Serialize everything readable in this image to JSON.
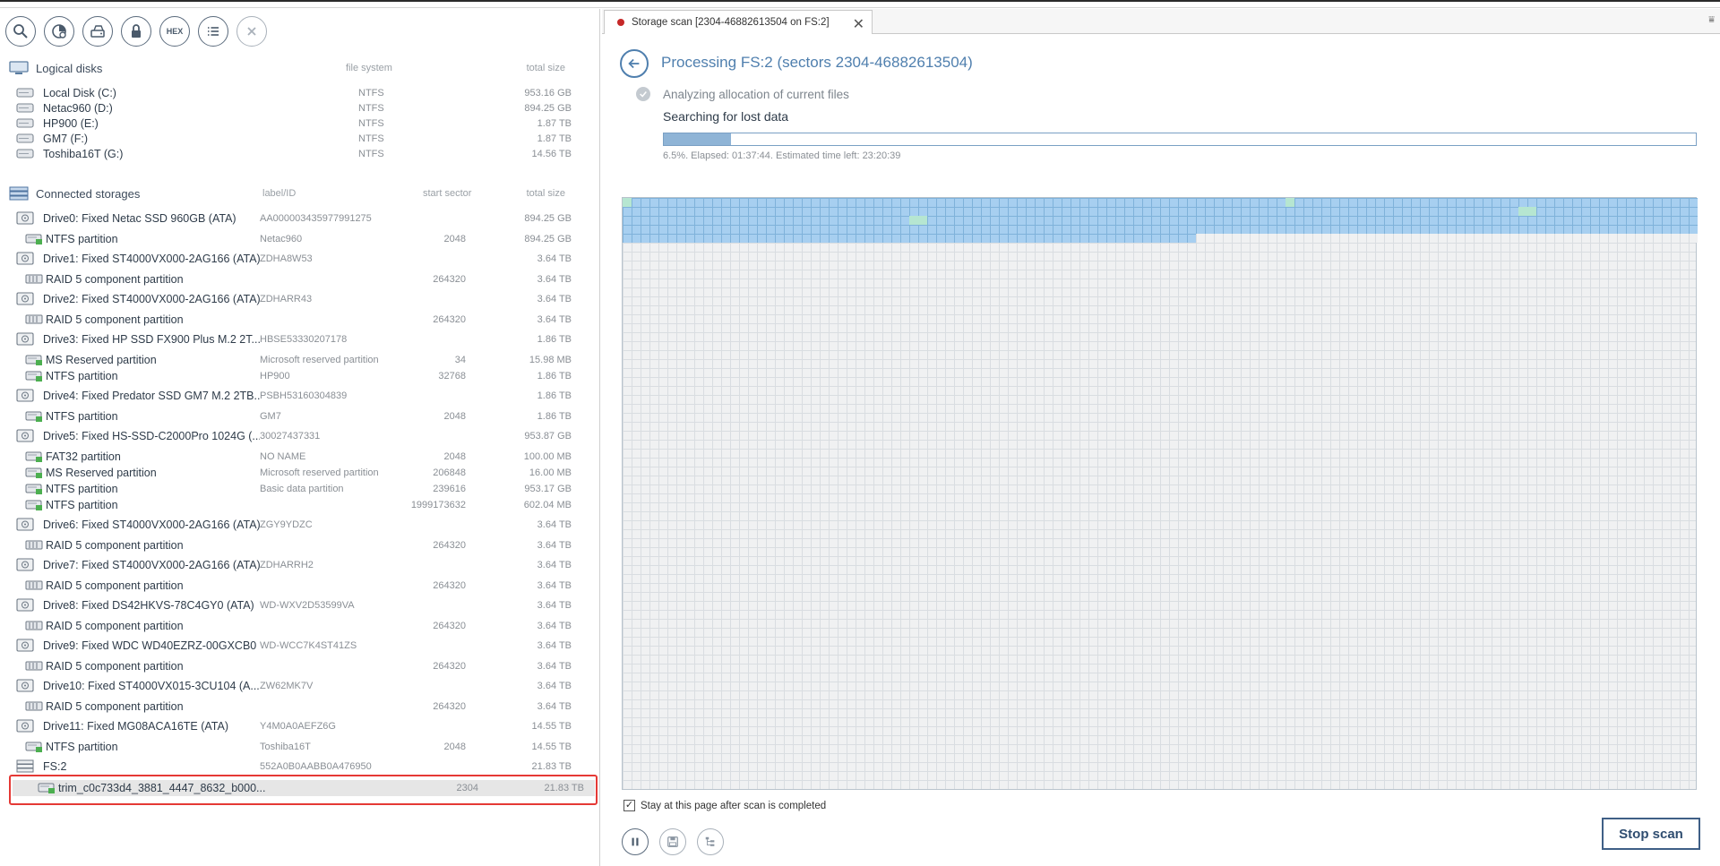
{
  "toolbar": {
    "buttons": [
      "search-icon",
      "scan-icon",
      "disk-image-icon",
      "lock-icon",
      "hex-icon",
      "list-icon",
      "close-icon"
    ],
    "hex_label": "HEX"
  },
  "logical": {
    "title": "Logical disks",
    "col_fs": "file system",
    "col_size": "total size",
    "items": [
      {
        "name": "Local Disk (C:)",
        "fs": "NTFS",
        "size": "953.16 GB"
      },
      {
        "name": "Netac960 (D:)",
        "fs": "NTFS",
        "size": "894.25 GB"
      },
      {
        "name": "HP900 (E:)",
        "fs": "NTFS",
        "size": "1.87 TB"
      },
      {
        "name": "GM7 (F:)",
        "fs": "NTFS",
        "size": "1.87 TB"
      },
      {
        "name": "Toshiba16T (G:)",
        "fs": "NTFS",
        "size": "14.56 TB"
      }
    ]
  },
  "storages": {
    "title": "Connected storages",
    "col_label": "label/ID",
    "col_start": "start sector",
    "col_size": "total size",
    "items": [
      {
        "kind": "drive",
        "name": "Drive0: Fixed Netac SSD 960GB (ATA)",
        "label": "AA000003435977991275",
        "start": "",
        "size": "894.25 GB"
      },
      {
        "kind": "part",
        "name": "NTFS partition",
        "label": "Netac960",
        "start": "2048",
        "size": "894.25 GB"
      },
      {
        "kind": "drive",
        "name": "Drive1: Fixed ST4000VX000-2AG166 (ATA)",
        "label": "ZDHA8W53",
        "start": "",
        "size": "3.64 TB"
      },
      {
        "kind": "raid",
        "name": "RAID 5 component partition",
        "label": "",
        "start": "264320",
        "size": "3.64 TB"
      },
      {
        "kind": "drive",
        "name": "Drive2: Fixed ST4000VX000-2AG166 (ATA)",
        "label": "ZDHARR43",
        "start": "",
        "size": "3.64 TB"
      },
      {
        "kind": "raid",
        "name": "RAID 5 component partition",
        "label": "",
        "start": "264320",
        "size": "3.64 TB"
      },
      {
        "kind": "drive",
        "name": "Drive3: Fixed HP SSD FX900 Plus M.2 2T...",
        "label": "HBSE53330207178",
        "start": "",
        "size": "1.86 TB"
      },
      {
        "kind": "part",
        "name": "MS Reserved partition",
        "label": "Microsoft reserved partition",
        "start": "34",
        "size": "15.98 MB"
      },
      {
        "kind": "part",
        "name": "NTFS partition",
        "label": "HP900",
        "start": "32768",
        "size": "1.86 TB"
      },
      {
        "kind": "drive",
        "name": "Drive4: Fixed Predator SSD GM7 M.2 2TB...",
        "label": "PSBH53160304839",
        "start": "",
        "size": "1.86 TB"
      },
      {
        "kind": "part",
        "name": "NTFS partition",
        "label": "GM7",
        "start": "2048",
        "size": "1.86 TB"
      },
      {
        "kind": "drive",
        "name": "Drive5: Fixed HS-SSD-C2000Pro 1024G (...",
        "label": "30027437331",
        "start": "",
        "size": "953.87 GB"
      },
      {
        "kind": "part",
        "name": "FAT32 partition",
        "label": "NO NAME",
        "start": "2048",
        "size": "100.00 MB"
      },
      {
        "kind": "part",
        "name": "MS Reserved partition",
        "label": "Microsoft reserved partition",
        "start": "206848",
        "size": "16.00 MB"
      },
      {
        "kind": "part",
        "name": "NTFS partition",
        "label": "Basic data partition",
        "start": "239616",
        "size": "953.17 GB"
      },
      {
        "kind": "part",
        "name": "NTFS partition",
        "label": "",
        "start": "1999173632",
        "size": "602.04 MB"
      },
      {
        "kind": "drive",
        "name": "Drive6: Fixed ST4000VX000-2AG166 (ATA)",
        "label": "ZGY9YDZC",
        "start": "",
        "size": "3.64 TB"
      },
      {
        "kind": "raid",
        "name": "RAID 5 component partition",
        "label": "",
        "start": "264320",
        "size": "3.64 TB"
      },
      {
        "kind": "drive",
        "name": "Drive7: Fixed ST4000VX000-2AG166 (ATA)",
        "label": "ZDHARRH2",
        "start": "",
        "size": "3.64 TB"
      },
      {
        "kind": "raid",
        "name": "RAID 5 component partition",
        "label": "",
        "start": "264320",
        "size": "3.64 TB"
      },
      {
        "kind": "drive",
        "name": "Drive8: Fixed DS42HKVS-78C4GY0 (ATA)",
        "label": "WD-WXV2D53599VA",
        "start": "",
        "size": "3.64 TB"
      },
      {
        "kind": "raid",
        "name": "RAID 5 component partition",
        "label": "",
        "start": "264320",
        "size": "3.64 TB"
      },
      {
        "kind": "drive",
        "name": "Drive9: Fixed WDC WD40EZRZ-00GXCB0 ...",
        "label": "WD-WCC7K4ST41ZS",
        "start": "",
        "size": "3.64 TB"
      },
      {
        "kind": "raid",
        "name": "RAID 5 component partition",
        "label": "",
        "start": "264320",
        "size": "3.64 TB"
      },
      {
        "kind": "drive",
        "name": "Drive10: Fixed ST4000VX015-3CU104 (A...",
        "label": "ZW62MK7V",
        "start": "",
        "size": "3.64 TB"
      },
      {
        "kind": "raid",
        "name": "RAID 5 component partition",
        "label": "",
        "start": "264320",
        "size": "3.64 TB"
      },
      {
        "kind": "drive",
        "name": "Drive11: Fixed MG08ACA16TE (ATA)",
        "label": "Y4M0A0AEFZ6G",
        "start": "",
        "size": "14.55 TB"
      },
      {
        "kind": "part",
        "name": "NTFS partition",
        "label": "Toshiba16T",
        "start": "2048",
        "size": "14.55 TB"
      },
      {
        "kind": "fs",
        "name": "FS:2",
        "label": "552A0B0AABB0A476950",
        "start": "",
        "size": "21.83 TB"
      },
      {
        "kind": "part",
        "name": "trim_c0c733d4_3881_4447_8632_b000...",
        "label": "",
        "start": "2304",
        "size": "21.83 TB",
        "selected": true
      }
    ]
  },
  "tab": {
    "title": "Storage scan [2304-46882613504 on FS:2]",
    "close": "✕"
  },
  "scan": {
    "title": "Processing FS:2 (sectors 2304-46882613504)",
    "step_done": "Analyzing allocation of current files",
    "step_current": "Searching for lost data",
    "progress": 0.065,
    "status": "6.5%. Elapsed: 01:37:44. Estimated time left: 23:20:39",
    "stay_label": "Stay at this page after scan is completed",
    "stay_checked": true,
    "stop_label": "Stop scan"
  },
  "colors": {
    "accent": "#4f7fae",
    "highlight": "#e53935",
    "scanned": "#a7cff0",
    "found": "#b6e6d1"
  }
}
